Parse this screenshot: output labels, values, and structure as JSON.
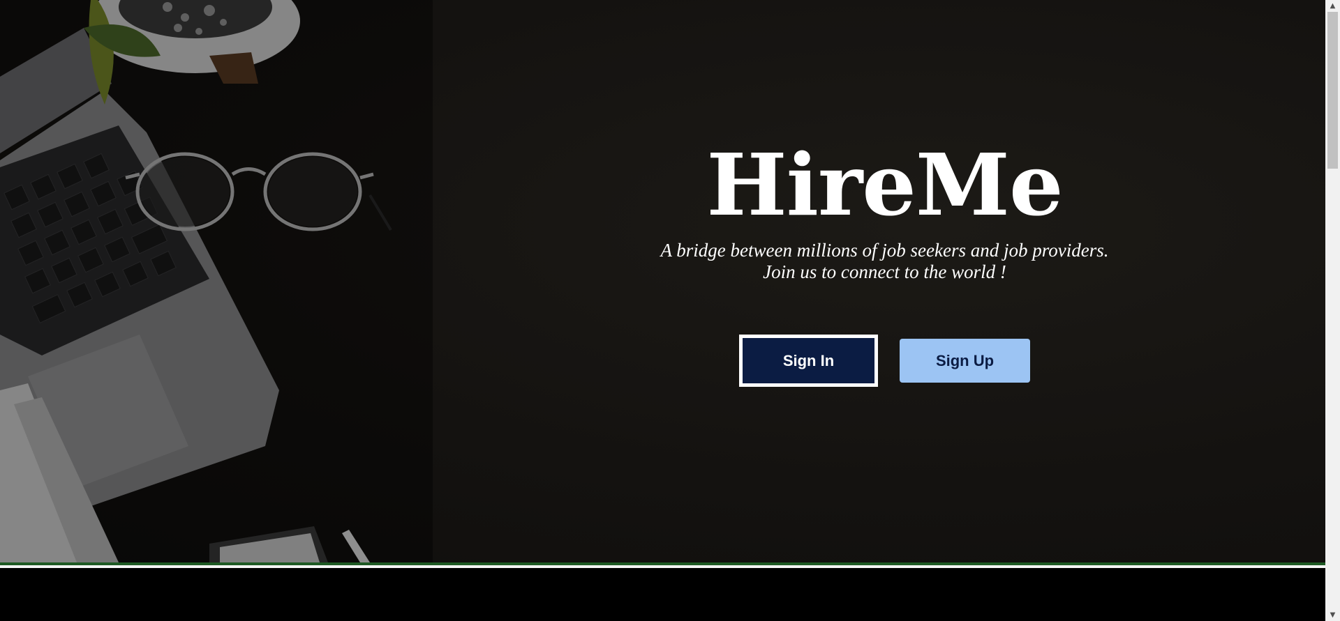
{
  "hero": {
    "title": "HireMe",
    "tagline_line1": "A bridge between millions of job seekers and job providers.",
    "tagline_line2": "Join us to connect to the world !"
  },
  "buttons": {
    "sign_in": "Sign In",
    "sign_up": "Sign Up"
  },
  "colors": {
    "sign_in_bg": "#0b1c43",
    "sign_up_bg": "#9cc4f3",
    "accent_line": "#1e5a24"
  },
  "icons": {
    "scroll_up": "triangle-up",
    "scroll_down": "triangle-down"
  }
}
